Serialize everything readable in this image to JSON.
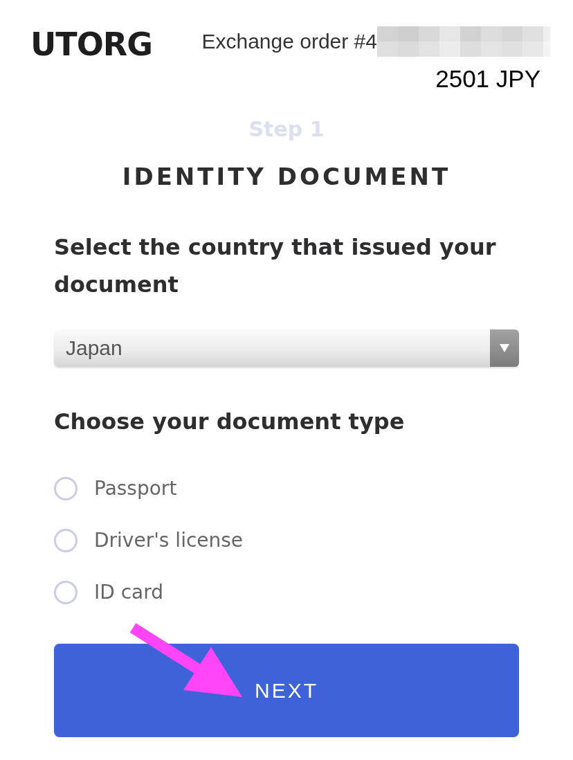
{
  "header": {
    "logo": "UTORG",
    "order_label": "Exchange order #4",
    "amount": "2501 JPY"
  },
  "step": "Step 1",
  "title": "IDENTITY DOCUMENT",
  "country": {
    "label": "Select the country that issued your document",
    "value": "Japan"
  },
  "document_type": {
    "label": "Choose your document type",
    "options": [
      {
        "label": "Passport",
        "selected": false
      },
      {
        "label": "Driver's license",
        "selected": false
      },
      {
        "label": "ID card",
        "selected": false
      }
    ]
  },
  "next_button": "NEXT"
}
